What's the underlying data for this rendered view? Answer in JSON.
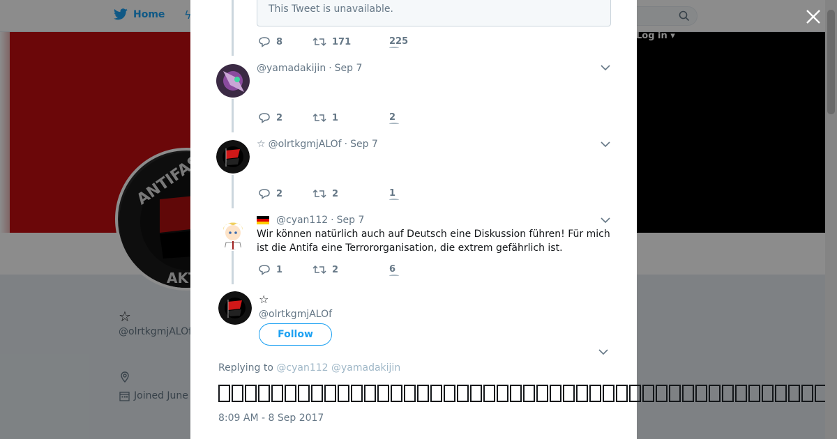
{
  "background": {
    "nav_home_label": "Home",
    "login_label": "Log in",
    "profile_name": "☆",
    "profile_handle": "@olrtkgmjALOf",
    "profile_joined": "Joined June",
    "banner_color": "#c40e12"
  },
  "modal": {
    "quoted_unavailable": "This Tweet is unavailable.",
    "first_actions": {
      "replies": "8",
      "retweets": "171",
      "likes": "225"
    },
    "tweets": [
      {
        "handle": "@yamadakijin",
        "date": "Sep 7",
        "text": "",
        "replies": "2",
        "retweets": "1",
        "likes": "2"
      },
      {
        "name_prefix": "☆",
        "handle": "@olrtkgmjALOf",
        "date": "Sep 7",
        "text": "",
        "replies": "2",
        "retweets": "2",
        "likes": "1"
      },
      {
        "flag": "de",
        "handle": "@cyan112",
        "date": "Sep 7",
        "text": "Wir können natürlich auch auf Deutsch eine Diskussion führen! Für mich ist die Antifa eine Terrororganisation, die extrem gefährlich ist.",
        "replies": "1",
        "retweets": "2",
        "likes": "6"
      }
    ],
    "permalink": {
      "name": "☆",
      "handle": "@olrtkgmjALOf",
      "follow_label": "Follow",
      "replying_label": "Replying to",
      "replying_to": [
        "@cyan112",
        "@yamadakijin"
      ],
      "timestamp": "8:09 AM - 8 Sep 2017",
      "unrendered_char_count": 46
    }
  },
  "colors": {
    "accent": "#1da1f2",
    "muted": "#657786",
    "border": "#ccd6dd"
  }
}
